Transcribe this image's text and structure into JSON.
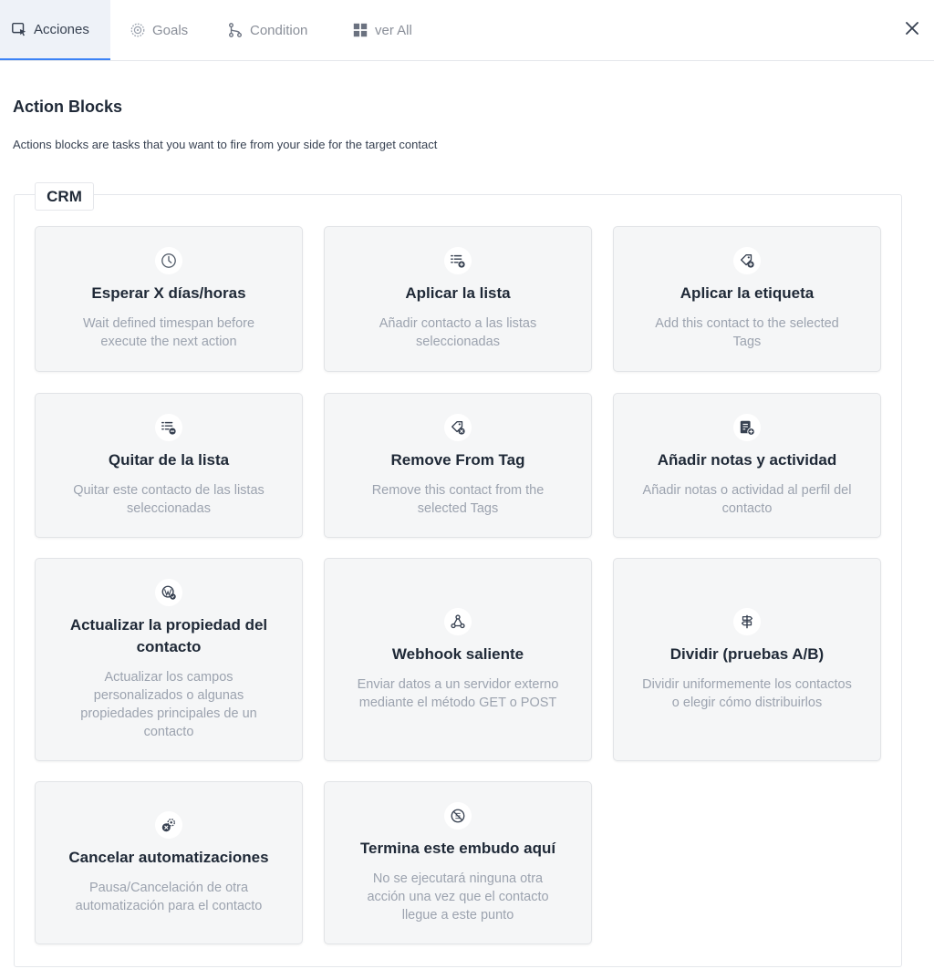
{
  "tabs": [
    {
      "label": "Acciones",
      "icon": "cursor-select-icon",
      "active": true
    },
    {
      "label": "Goals",
      "icon": "target-icon",
      "active": false
    },
    {
      "label": "Condition",
      "icon": "branch-icon",
      "active": false
    },
    {
      "label": "ver All",
      "icon": "grid-icon",
      "active": false
    }
  ],
  "close_icon": "close-icon",
  "heading": {
    "title": "Action Blocks",
    "description": "Actions blocks are tasks that you want to fire from your side for the target contact"
  },
  "section": {
    "label": "CRM",
    "cards": [
      {
        "icon": "clock-icon",
        "title": "Esperar X días/horas",
        "description": "Wait defined timespan before execute the next action"
      },
      {
        "icon": "list-add-icon",
        "title": "Aplicar la lista",
        "description": "Añadir contacto a las listas seleccionadas"
      },
      {
        "icon": "tag-add-icon",
        "title": "Aplicar la etiqueta",
        "description": "Add this contact to the selected Tags"
      },
      {
        "icon": "list-remove-icon",
        "title": "Quitar de la lista",
        "description": "Quitar este contacto de las listas seleccionadas"
      },
      {
        "icon": "tag-remove-icon",
        "title": "Remove From Tag",
        "description": "Remove this contact from the selected Tags"
      },
      {
        "icon": "note-add-icon",
        "title": "Añadir notas y actividad",
        "description": "Añadir notas o actividad al perfil del contacto"
      },
      {
        "icon": "wordpress-icon",
        "title": "Actualizar la propiedad del contacto",
        "description": "Actualizar los campos personalizados o algunas propiedades principales de un contacto"
      },
      {
        "icon": "webhook-icon",
        "title": "Webhook saliente",
        "description": "Enviar datos a un servidor externo mediante el método GET o POST"
      },
      {
        "icon": "signpost-icon",
        "title": "Dividir (pruebas A/B)",
        "description": "Dividir uniformemente los contactos o elegir cómo distribuirlos"
      },
      {
        "icon": "cancel-automation-icon",
        "title": "Cancelar automatizaciones",
        "description": "Pausa/Cancelación de otra automatización para el contacto"
      },
      {
        "icon": "stop-icon",
        "title": "Termina este embudo aquí",
        "description": "No se ejecutará ninguna otra acción una vez que el contacto llegue a este punto"
      }
    ]
  },
  "colors": {
    "accent": "#3b82f6",
    "card_bg": "#f5f6f7",
    "muted_text": "#9ca3af"
  }
}
